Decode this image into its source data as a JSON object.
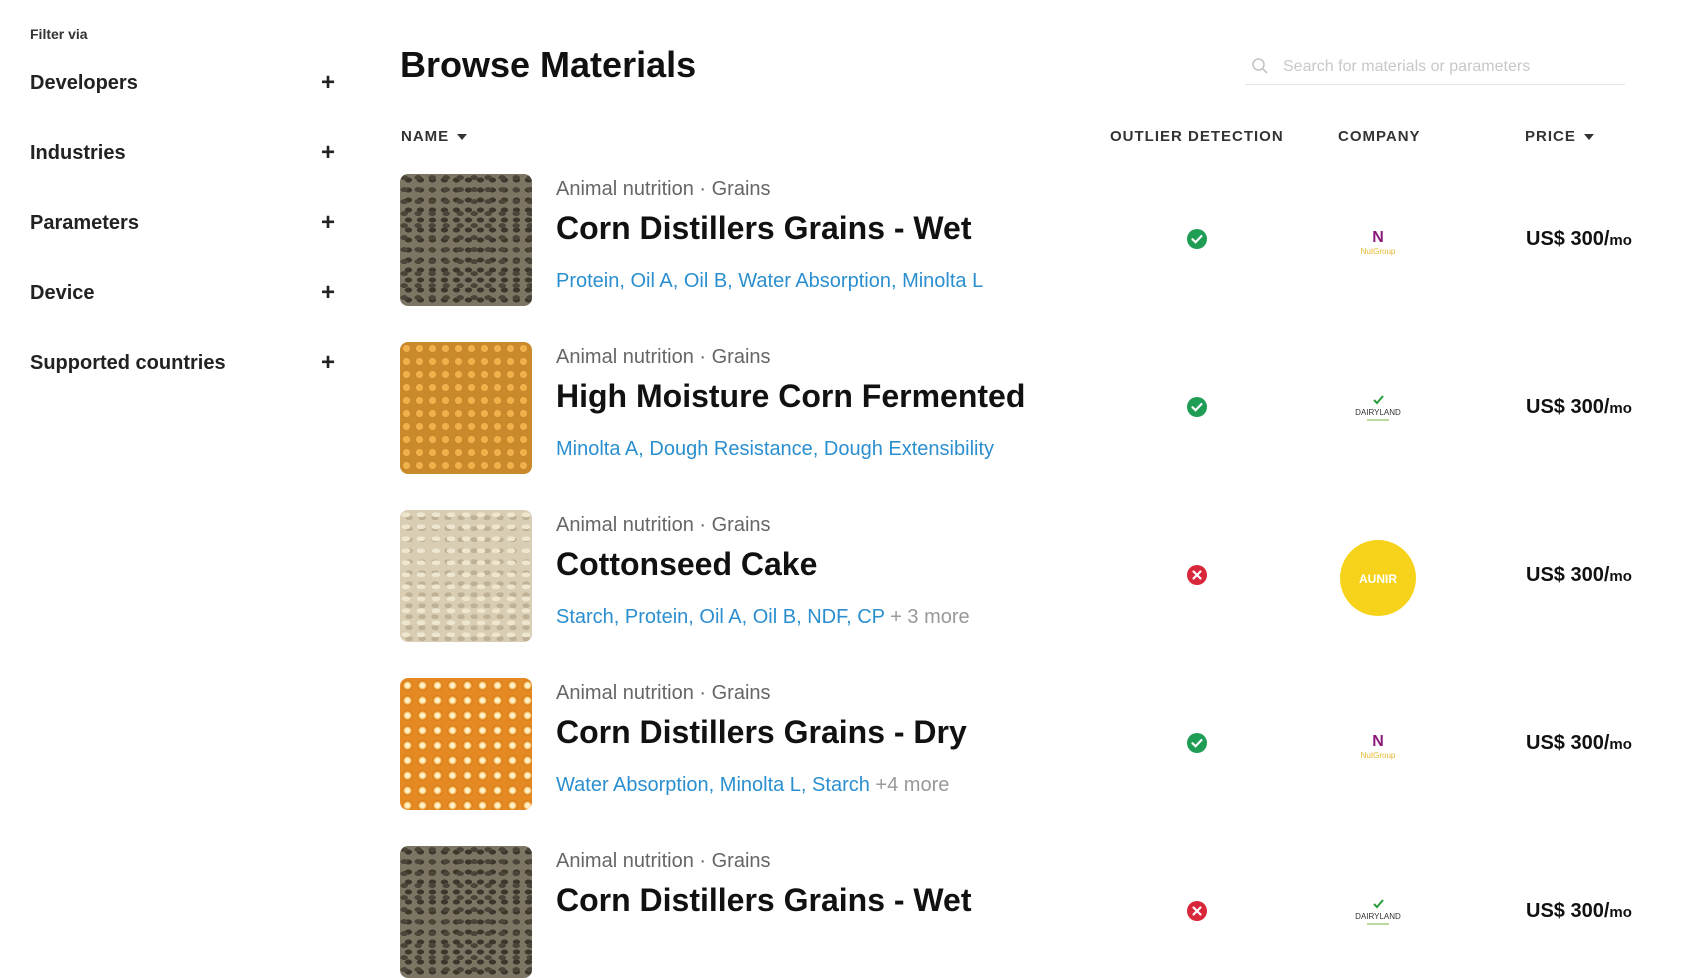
{
  "sidebar": {
    "filter_label": "Filter via",
    "filters": [
      {
        "label": "Developers"
      },
      {
        "label": "Industries"
      },
      {
        "label": "Parameters"
      },
      {
        "label": "Device"
      },
      {
        "label": "Supported countries"
      }
    ],
    "expand_symbol": "+"
  },
  "header": {
    "title": "Browse Materials",
    "search_placeholder": "Search for materials or parameters"
  },
  "columns": {
    "name": "NAME",
    "outlier": "OUTLIER DETECTION",
    "company": "COMPANY",
    "price": "PRICE"
  },
  "rows": [
    {
      "category": "Animal nutrition · Grains",
      "name": "Corn Distillers Grains - Wet",
      "params": "Protein, Oil A, Oil B, Water Absorption, Minolta L",
      "more": "",
      "outlier": "yes",
      "company_logo": "N NutGroup",
      "price": "US$ 300/",
      "price_unit": "mo"
    },
    {
      "category": "Animal nutrition · Grains",
      "name": "High Moisture Corn Fermented",
      "params": "Minolta A, Dough Resistance, Dough Extensibility",
      "more": "",
      "outlier": "yes",
      "company_logo": "DAIRYLAND",
      "price": "US$ 300/",
      "price_unit": "mo"
    },
    {
      "category": "Animal nutrition · Grains",
      "name": "Cottonseed Cake",
      "params": "Starch, Protein, Oil A, Oil B, NDF, CP",
      "more": "+ 3 more",
      "outlier": "no",
      "company_logo": "AUNIR",
      "price": "US$ 300/",
      "price_unit": "mo"
    },
    {
      "category": "Animal nutrition · Grains",
      "name": "Corn Distillers Grains - Dry",
      "params": "Water Absorption, Minolta L, Starch",
      "more": "+4 more",
      "outlier": "yes",
      "company_logo": "N NutGroup",
      "price": "US$ 300/",
      "price_unit": "mo"
    },
    {
      "category": "Animal nutrition · Grains",
      "name": "Corn Distillers Grains - Wet",
      "params": "",
      "more": "",
      "outlier": "no",
      "company_logo": "DAIRYLAND",
      "price": "US$ 300/",
      "price_unit": "mo"
    }
  ],
  "colors": {
    "accent_link": "#2b8fcf",
    "check_green": "#1f9d55",
    "cross_red": "#d8263a",
    "aunir_yellow": "#f6d31a"
  }
}
